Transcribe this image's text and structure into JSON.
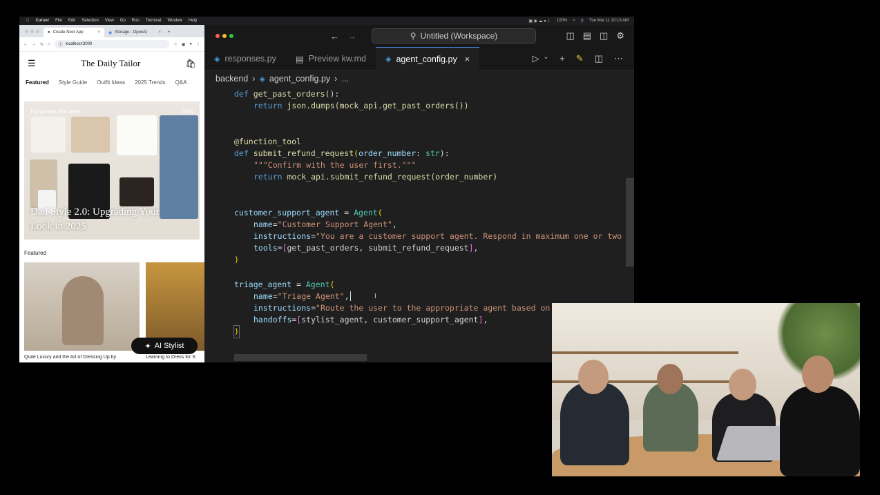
{
  "menubar": {
    "app": "Cursor",
    "items": [
      "File",
      "Edit",
      "Selection",
      "View",
      "Go",
      "Run",
      "Terminal",
      "Window",
      "Help"
    ],
    "battery": "100%",
    "clock": "Tue Mar 11 10:13 AM"
  },
  "browser": {
    "tabs": [
      {
        "label": "Create Next App"
      },
      {
        "label": "Storage - OpenAI"
      }
    ],
    "url": "localhost:3000"
  },
  "site": {
    "title": "The Daily Tailor",
    "nav": [
      "Featured",
      "Style Guide",
      "Outfit Ideas",
      "2025 Trends",
      "Q&A"
    ],
    "hero": {
      "kicker": "Top guides this week",
      "dots_label": "Dots",
      "title": "Dad Style 2.0: Upgrading Your Look in 2025"
    },
    "featured_label": "Featured",
    "cards": [
      {
        "caption": "Quite Luxury and the Art of Dressing Up by"
      },
      {
        "caption": "Learning to Dress for S"
      }
    ],
    "ai_button": "AI Stylist"
  },
  "editor": {
    "workspace": "Untitled (Workspace)",
    "tabs": [
      {
        "label": "responses.py"
      },
      {
        "label": "Preview kw.md"
      },
      {
        "label": "agent_config.py"
      }
    ],
    "breadcrumb": {
      "folder": "backend",
      "file": "agent_config.py",
      "more": "..."
    },
    "code": {
      "l1_def": "def",
      "l1_name": "get_past_orders",
      "l1_rest": "():",
      "l2_return": "return",
      "l2_expr": "json.dumps(mock_api.get_past_orders())",
      "l3_decorator": "@function_tool",
      "l4_def": "def",
      "l4_name": "submit_refund_request",
      "l4_param": "order_number",
      "l4_type": "str",
      "l4_end": "):",
      "l5_doc": "\"\"\"Confirm with the user first.\"\"\"",
      "l6_return": "return",
      "l6_expr": "mock_api.submit_refund_request(order_number)",
      "l7_var": "customer_support_agent",
      "l7_cls": "Agent",
      "l8_key": "name",
      "l8_val": "\"Customer Support Agent\"",
      "l9_key": "instructions",
      "l9_val": "\"You are a customer support agent. Respond in maximum one or two s",
      "l10_key": "tools",
      "l10_val": "get_past_orders, submit_refund_request",
      "l11_close": ")",
      "l12_var": "triage_agent",
      "l12_cls": "Agent",
      "l13_key": "name",
      "l13_val": "\"Triage Agent\"",
      "l14_key": "instructions",
      "l14_val": "\"Route the user to the appropriate agent based on",
      "l15_key": "handoffs",
      "l15_val": "stylist_agent, customer_support_agent",
      "l16_close": ")"
    }
  },
  "colors": {
    "editor_bg": "#1f1f1f",
    "keyword": "#569cd6",
    "function": "#dcdcaa",
    "string": "#ce9178",
    "class": "#4ec9b0",
    "parameter": "#9cdcfe",
    "accent": "#4a8de8"
  }
}
